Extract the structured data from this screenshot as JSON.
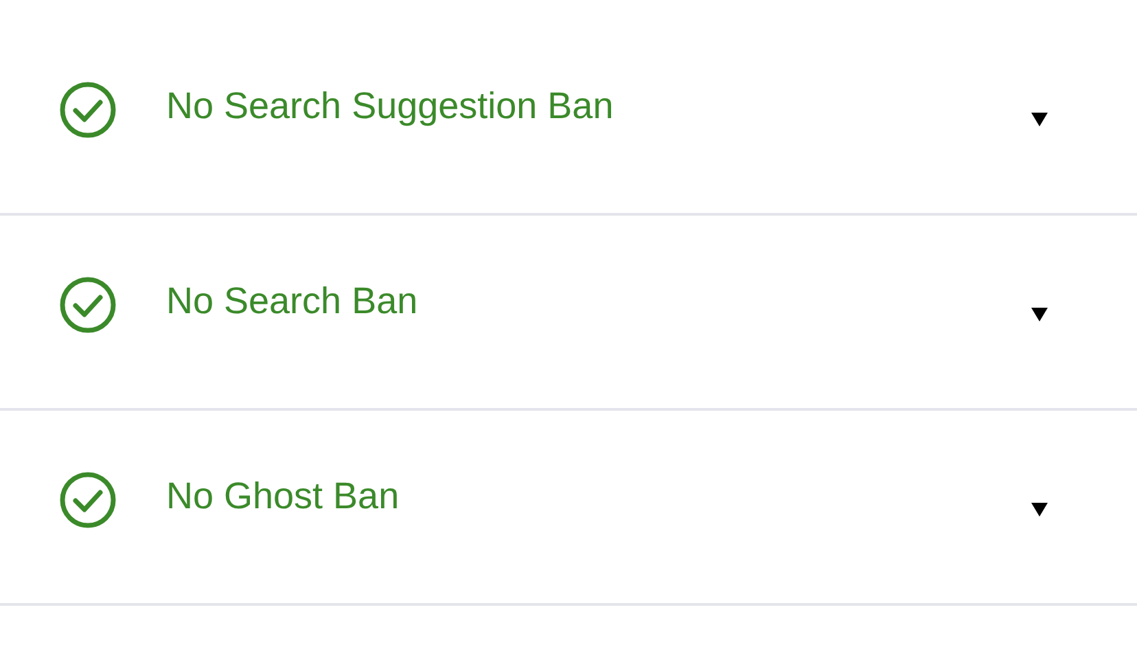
{
  "checks": [
    {
      "title": "No Search Suggestion Ban",
      "passed": true,
      "expanded": false
    },
    {
      "title": "No Search Ban",
      "passed": true,
      "expanded": false
    },
    {
      "title": "No Ghost Ban",
      "passed": true,
      "expanded": false
    }
  ]
}
